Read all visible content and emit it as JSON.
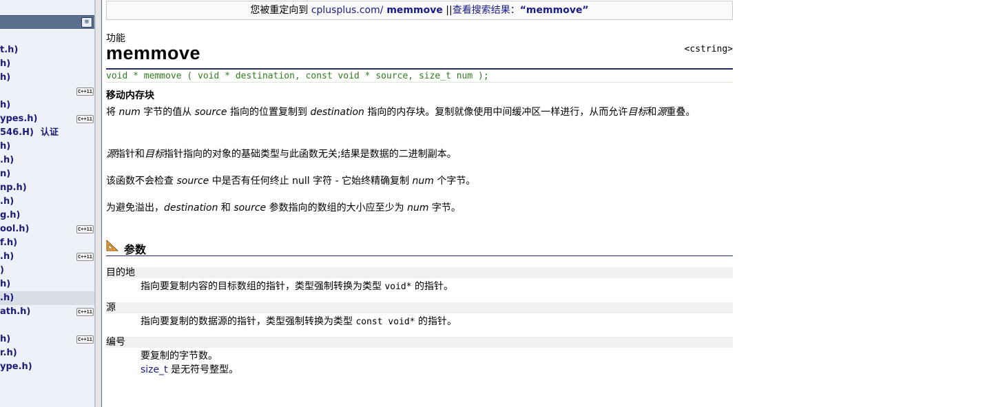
{
  "sidebar": {
    "header_icon": "book-icon",
    "items": [
      {
        "label": "t.h)",
        "badge": ""
      },
      {
        "label": "h)",
        "badge": ""
      },
      {
        "label": "h)",
        "badge": ""
      },
      {
        "label": "",
        "badge": "C++11"
      },
      {
        "label": "h)",
        "badge": ""
      },
      {
        "label": "ypes.h)",
        "badge": "C++11"
      },
      {
        "label": "546.H)",
        "badge": "",
        "extra": "认证"
      },
      {
        "label": "h)",
        "badge": ""
      },
      {
        "label": ".h)",
        "badge": ""
      },
      {
        "label": "n)",
        "badge": ""
      },
      {
        "label": "np.h)",
        "badge": ""
      },
      {
        "label": ".h)",
        "badge": ""
      },
      {
        "label": "g.h)",
        "badge": ""
      },
      {
        "label": "ool.h)",
        "badge": "C++11"
      },
      {
        "label": "f.h)",
        "badge": ""
      },
      {
        "label": ".h)",
        "badge": "C++11"
      },
      {
        "label": ")",
        "badge": ""
      },
      {
        "label": "h)",
        "badge": ""
      },
      {
        "label": ".h)",
        "badge": "",
        "active": true
      },
      {
        "label": "ath.h)",
        "badge": "C++11"
      },
      {
        "label": "",
        "badge": ""
      },
      {
        "label": "h)",
        "badge": "C++11"
      },
      {
        "label": "r.h)",
        "badge": ""
      },
      {
        "label": "ype.h)",
        "badge": ""
      }
    ]
  },
  "redirect": {
    "prefix": "您被重定向到 ",
    "link_text": "cplusplus.com/",
    "bold_text": " memmove",
    "separator": " ||",
    "search_text": "查看搜索结果：",
    "search_query": "“memmove”"
  },
  "page": {
    "label": "功能",
    "title": "memmove",
    "header": "<cstring>",
    "prototype": "void * memmove ( void * destination, const void * source, size_t num );",
    "summary": "移动内存块"
  },
  "description": {
    "p1": {
      "a": "将 ",
      "b": "num",
      "c": " 字节的值从 ",
      "d": "source",
      "e": " 指向的位置复制到 ",
      "f": "destination",
      "g": " 指向的内存块。复制就像使用中间缓冲区一样进行，从而允许",
      "h": "目标",
      "i": "和",
      "j": "源",
      "k": "重叠。"
    },
    "p2": {
      "a": "源",
      "b": "指针和",
      "c": "目标",
      "d": "指针指向的对象的基础类型与此函数无关;结果是数据的二进制副本。"
    },
    "p3": {
      "a": "该函数不会检查 ",
      "b": "source",
      "c": " 中是否有任何终止 null 字符 - 它始终精确复制 ",
      "d": "num",
      "e": " 个字节。"
    },
    "p4": {
      "a": "为避免溢出，",
      "b": "destination",
      "c": " 和 ",
      "d": "source",
      "e": " 参数指向的数组的大小应至少为 ",
      "f": "num",
      "g": " 字节。"
    }
  },
  "params": {
    "section_title": "参数",
    "section_icon": "triangle-ruler-icon",
    "destination": {
      "name": "目的地",
      "desc_a": "指向要复制内容的目标数组的指针，类型强制转换为类型 ",
      "desc_code": "void*",
      "desc_b": " 的指针。"
    },
    "source": {
      "name": "源",
      "desc_a": "指向要复制的数据源的指针，类型强制转换为类型 ",
      "desc_code": "const void*",
      "desc_b": " 的指针。"
    },
    "num": {
      "name": "编号",
      "desc_line1": "要复制的字节数。",
      "desc_link": "size_t",
      "desc_line2": " 是无符号整型。"
    }
  }
}
